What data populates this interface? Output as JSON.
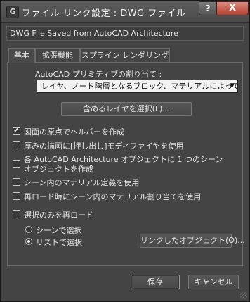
{
  "window": {
    "title": "ファイル リンク設定 : DWG ファイル",
    "app_icon": "G",
    "help_label": "?",
    "close_label": "X"
  },
  "description": "DWG File Saved from AutoCAD Architecture",
  "tabs": [
    {
      "label": "基本",
      "active": true
    },
    {
      "label": "拡張機能",
      "active": false
    },
    {
      "label": "スプライン レンダリング",
      "active": false
    }
  ],
  "primitive": {
    "label": "AutoCAD プリミティブの割り当て :",
    "selected": "レイヤ、ノード階層となるブロック、マテリアルによって分割"
  },
  "select_layers_button": "含めるレイヤを選択(L)...",
  "options": [
    {
      "label": "図面の原点でヘルパーを作成",
      "checked": true
    },
    {
      "label": "厚みの描画に[押し出し]モディファイヤを使用",
      "checked": false
    },
    {
      "label_line1": "各 AutoCAD Architecture オブジェクトに 1 つのシーン",
      "label_line2": "オブジェクトを作成",
      "checked": false
    },
    {
      "label": "シーン内のマテリアル定義を使用",
      "checked": false
    },
    {
      "label": "再ロード時にシーン内のマテリアル割り当てを使用",
      "checked": false
    },
    {
      "label": "選択のみを再ロード",
      "checked": false
    }
  ],
  "reload_mode": {
    "options": [
      {
        "label": "シーンで選択",
        "selected": false
      },
      {
        "label": "リストで選択",
        "selected": true
      }
    ]
  },
  "linked_objects_button": "リンクしたオブジェクト(O)...",
  "footer": {
    "save_label": "保存",
    "cancel_label": "キャンセル"
  }
}
